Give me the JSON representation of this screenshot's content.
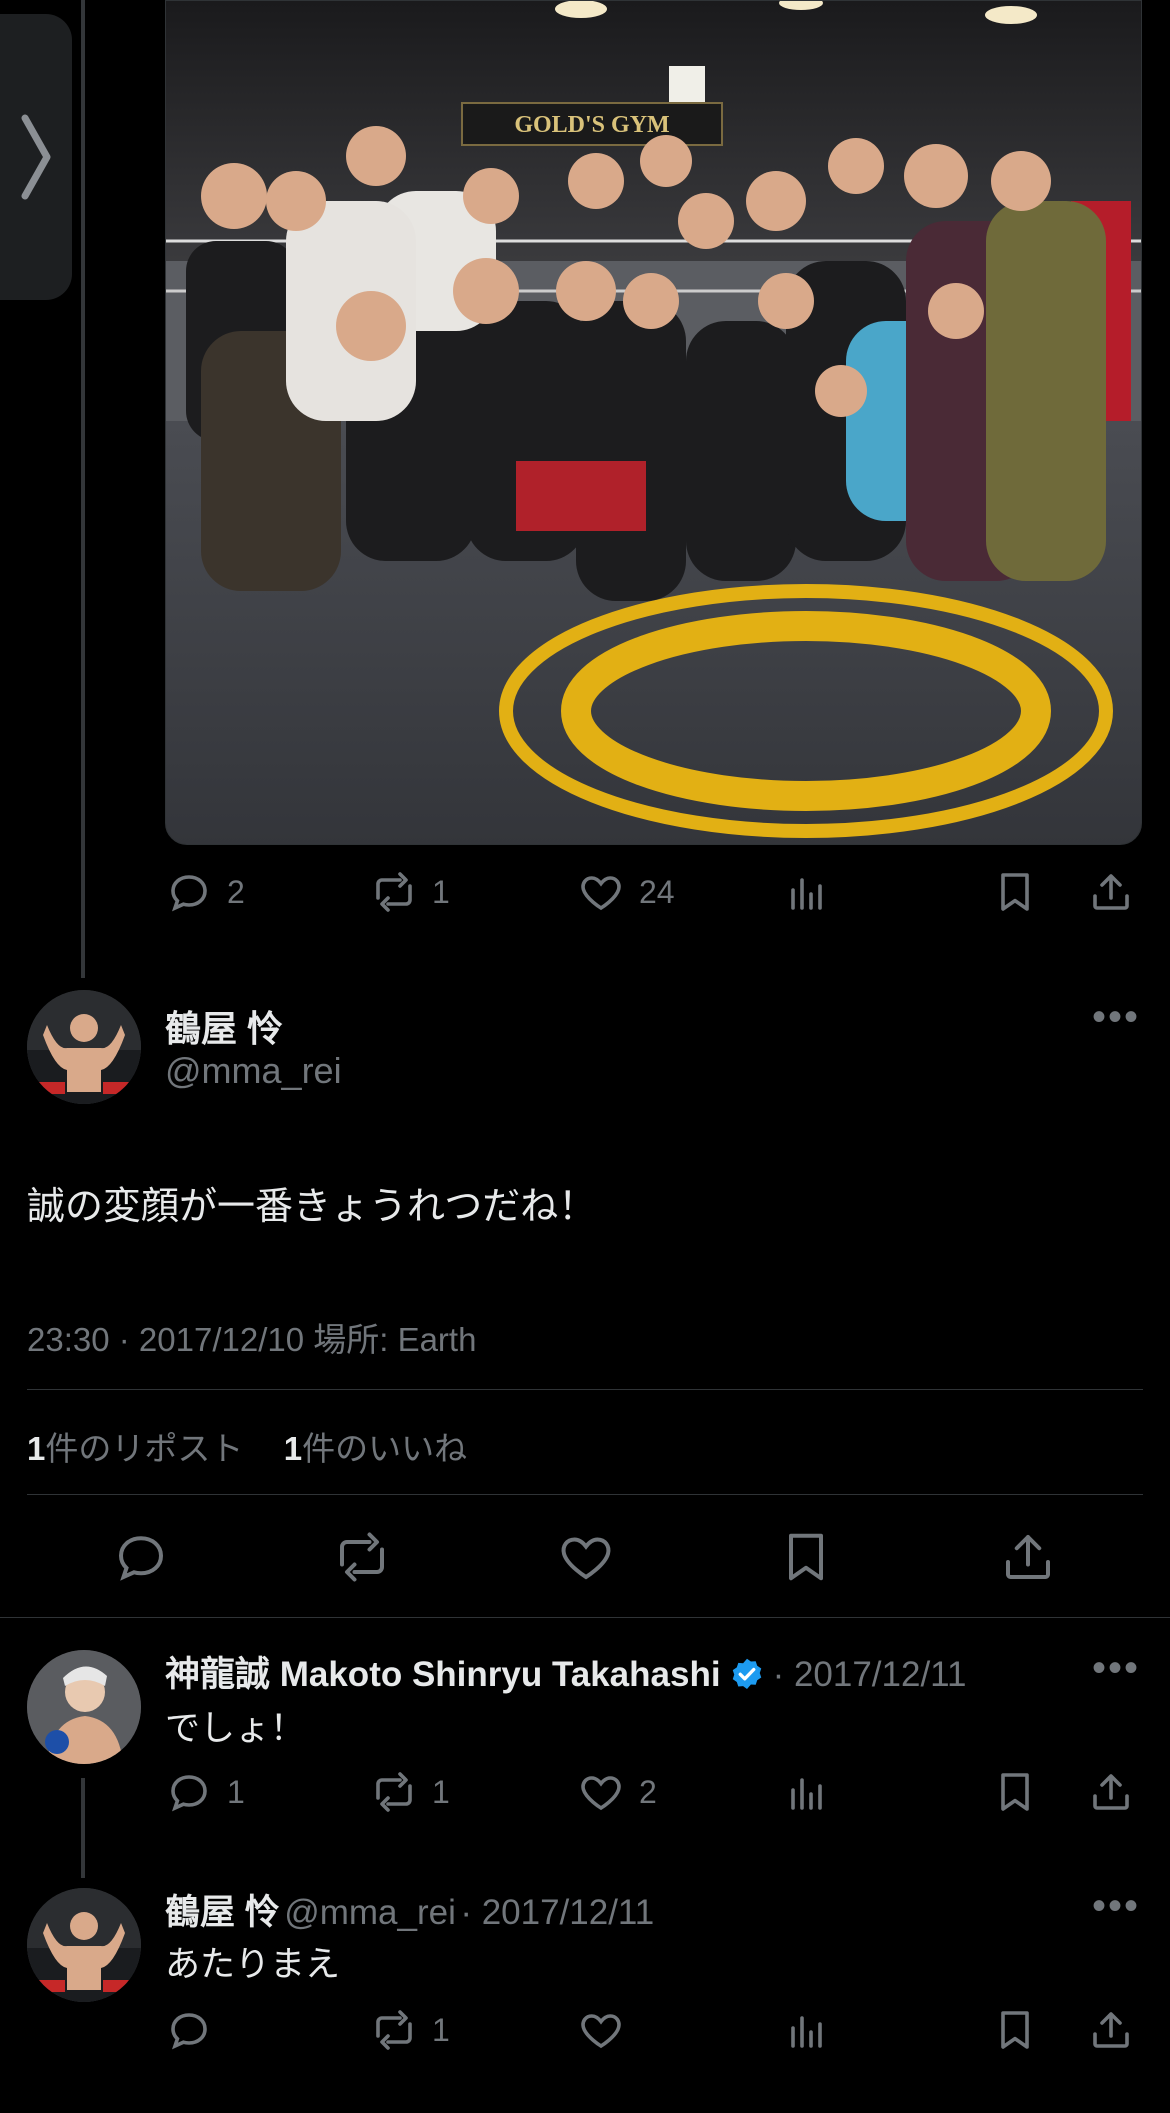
{
  "top_tweet": {
    "photo": {
      "sign_text": "GOLD'S GYM"
    },
    "actions": {
      "replies": "2",
      "reposts": "1",
      "likes": "24"
    }
  },
  "main_tweet": {
    "author_name": "鶴屋 怜",
    "author_handle": "@mma_rei",
    "text": "誠の変顔が一番きょうれつだね！",
    "meta": "23:30 · 2017/12/10 場所: Earth",
    "stats": {
      "reposts_count": "1",
      "reposts_label": "件のリポスト",
      "likes_count": "1",
      "likes_label": "件のいいね"
    }
  },
  "replies": [
    {
      "author_name": "神龍誠 Makoto Shinryu Takahashi",
      "verified": true,
      "date": "· 2017/12/11",
      "text": "でしょ！",
      "replies": "1",
      "reposts": "1",
      "likes": "2"
    },
    {
      "author_name": "鶴屋 怜",
      "author_handle": "@mma_rei",
      "date": "· 2017/12/11",
      "text": "あたりまえ",
      "replies": "",
      "reposts": "1",
      "likes": ""
    }
  ],
  "icons": [
    "reply-icon",
    "repost-icon",
    "like-icon",
    "views-icon",
    "bookmark-icon",
    "share-icon",
    "more-icon",
    "verified-icon",
    "chevron-right-icon"
  ],
  "colors": {
    "background": "#000000",
    "text": "#e7e9ea",
    "muted": "#71767b",
    "verified": "#1d9bf0",
    "mat_logo": "#e2b014"
  }
}
